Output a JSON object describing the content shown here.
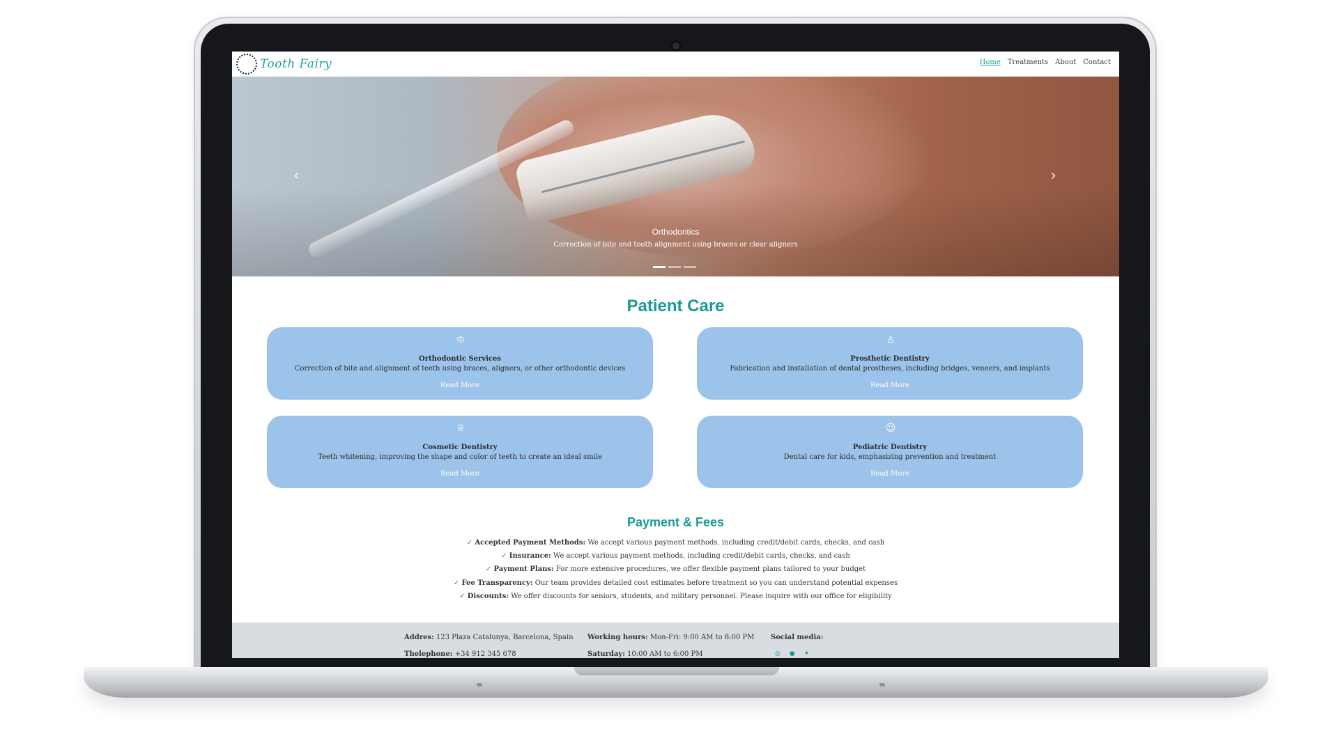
{
  "brand": {
    "name": "Tooth Fairy",
    "accent": "#1a9a93",
    "card_color": "#9cc3ea",
    "footer_color": "#d8dde2"
  },
  "nav": {
    "items": [
      "Home",
      "Treatments",
      "About",
      "Contact"
    ],
    "active": "Home"
  },
  "hero": {
    "title": "Orthodontics",
    "subtitle": "Correction of bite and tooth alignment using braces or clear aligners",
    "prev_icon": "chevron-left-icon",
    "next_icon": "chevron-right-icon",
    "slides": 3,
    "active_slide": 1
  },
  "patient_care": {
    "title": "Patient Care",
    "cards": [
      {
        "title": "Orthodontic Services",
        "description": "Correction of bite and alignment of teeth using braces, aligners, or other orthodontic devices",
        "link": "Read More",
        "icon": "braces-tooth-icon"
      },
      {
        "title": "Prosthetic Dentistry",
        "description": "Fabrication and installation of dental prostheses, including bridges, veneers, and implants",
        "link": "Read More",
        "icon": "tooth-icon"
      },
      {
        "title": "Cosmetic Dentistry",
        "description": "Teeth whitening, improving the shape and color of teeth to create an ideal smile",
        "link": "Read More",
        "icon": "sparkle-tooth-icon"
      },
      {
        "title": "Pediatric Dentistry",
        "description": "Dental care for kids, emphasizing prevention and treatment",
        "link": "Read More",
        "icon": "smile-icon"
      }
    ]
  },
  "payment": {
    "title": "Payment & Fees",
    "items": [
      {
        "label": "Accepted Payment Methods:",
        "text": "We accept various payment methods, including credit/debit cards, checks, and cash"
      },
      {
        "label": "Insurance:",
        "text": "We accept various payment methods, including credit/debit cards, checks, and cash"
      },
      {
        "label": "Payment Plans:",
        "text": "For more extensive procedures, we offer flexible payment plans tailored to your budget"
      },
      {
        "label": "Fee Transparency:",
        "text": "Our team provides detailed cost estimates before treatment so you can understand potential expenses"
      },
      {
        "label": "Discounts:",
        "text": "We offer discounts for seniors, students, and military personnel. Please inquire with our office for eligibility"
      }
    ]
  },
  "footer": {
    "address_label": "Addres:",
    "address": "123 Plaza Catalunya, Barcelona, Spain",
    "phone_label": "Thelephone:",
    "phone": "+34 912 345 678",
    "hours_label": "Working hours:",
    "hours": "Mon-Fri: 9:00 AM to 8:00 PM",
    "saturday_label": "Saturday:",
    "saturday": "10:00 AM to 6:00 PM",
    "social_label": "Social media:",
    "social_icons": [
      "instagram-icon",
      "facebook-icon",
      "twitter-icon"
    ]
  }
}
